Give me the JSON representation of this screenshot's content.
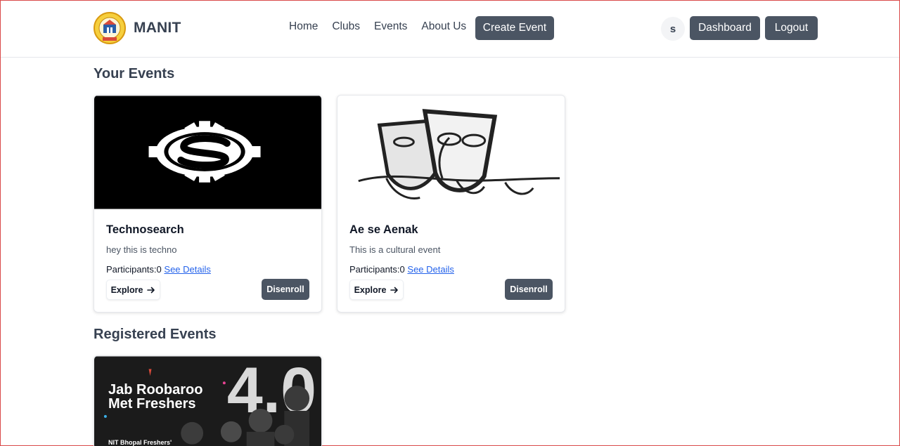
{
  "header": {
    "brand": "MANIT",
    "nav": [
      "Home",
      "Clubs",
      "Events",
      "About Us"
    ],
    "create_event": "Create Event",
    "avatar_letter": "s",
    "dashboard": "Dashboard",
    "logout": "Logout"
  },
  "sections": {
    "your_events": "Your Events",
    "registered_events": "Registered Events"
  },
  "your_events": [
    {
      "title": "Technosearch",
      "description": "hey this is techno",
      "participants_label": "Participants:",
      "participants": "0",
      "details_link": "See Details",
      "explore": "Explore",
      "disenroll": "Disenroll"
    },
    {
      "title": "Ae se Aenak",
      "description": "This is a cultural event",
      "participants_label": "Participants:",
      "participants": "0",
      "details_link": "See Details",
      "explore": "Explore",
      "disenroll": "Disenroll"
    }
  ],
  "registered_events": [
    {
      "poster_line1": "Jab Roobaroo",
      "poster_line2": "Met Freshers",
      "poster_number": "4.0",
      "poster_foot": "NIT Bhopal Freshers'"
    }
  ],
  "colors": {
    "button_dark": "#4b5563",
    "link": "#2563eb",
    "logo_gold": "#e8b21e",
    "logo_blue": "#2b5ea7"
  }
}
